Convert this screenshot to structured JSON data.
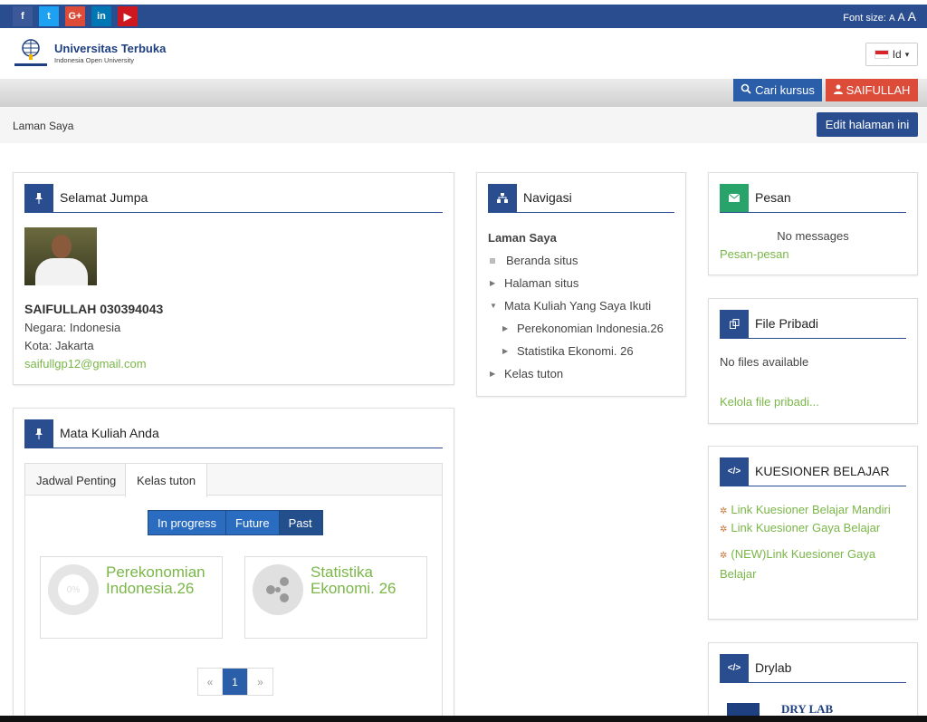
{
  "topbar": {
    "social": [
      {
        "icon": "facebook-icon",
        "glyph": "f",
        "color": "#3b5998"
      },
      {
        "icon": "twitter-icon",
        "glyph": "t",
        "color": "#1da1f2"
      },
      {
        "icon": "googleplus-icon",
        "glyph": "G+",
        "color": "#dd4b39"
      },
      {
        "icon": "linkedin-icon",
        "glyph": "in",
        "color": "#0077b5"
      },
      {
        "icon": "youtube-icon",
        "glyph": "▶",
        "color": "#cc181e"
      }
    ],
    "font_size_label": "Font size:",
    "font_size_options": [
      "A",
      "A",
      "A"
    ]
  },
  "header": {
    "logo_title": "Universitas Terbuka",
    "logo_subtitle": "Indonesia Open University",
    "language": "Id"
  },
  "nav_buttons": {
    "search": "Cari kursus",
    "user": "SAIFULLAH"
  },
  "breadcrumb": "Laman Saya",
  "edit_button": "Edit halaman ini",
  "welcome": {
    "title": "Selamat Jumpa",
    "name": "SAIFULLAH 030394043",
    "country": "Negara: Indonesia",
    "city": "Kota: Jakarta",
    "email": "saifullgp12@gmail.com"
  },
  "courses": {
    "title": "Mata Kuliah Anda",
    "tabs": [
      "Jadwal Penting",
      "Kelas tuton"
    ],
    "filters": [
      "In progress",
      "Future",
      "Past"
    ],
    "items": [
      {
        "name": "Perekonomian Indonesia.26",
        "progress": "0%"
      },
      {
        "name": "Statistika Ekonomi. 26"
      }
    ],
    "pager": {
      "prev": "«",
      "page": "1",
      "next": "»"
    }
  },
  "navigasi": {
    "title": "Navigasi",
    "root": "Laman Saya",
    "items": [
      "Beranda situs",
      "Halaman situs",
      "Mata Kuliah Yang Saya Ikuti",
      "Perekonomian Indonesia.26",
      "Statistika Ekonomi. 26",
      "Kelas tuton"
    ]
  },
  "pesan": {
    "title": "Pesan",
    "empty": "No messages",
    "link": "Pesan-pesan"
  },
  "files": {
    "title": "File Pribadi",
    "empty": "No files available",
    "link": "Kelola file pribadi..."
  },
  "kuesioner": {
    "title": "KUESIONER BELAJAR",
    "links": [
      "Link Kuesioner Belajar Mandiri",
      "Link Kuesioner Gaya Belajar",
      "(NEW)Link Kuesioner Gaya Belajar"
    ]
  },
  "drylab": {
    "title": "Drylab",
    "image_text": "DRY LAB"
  },
  "colors": {
    "brand": "#2a4d8f",
    "accent_green": "#7ab648",
    "user_red": "#dd4b39"
  }
}
